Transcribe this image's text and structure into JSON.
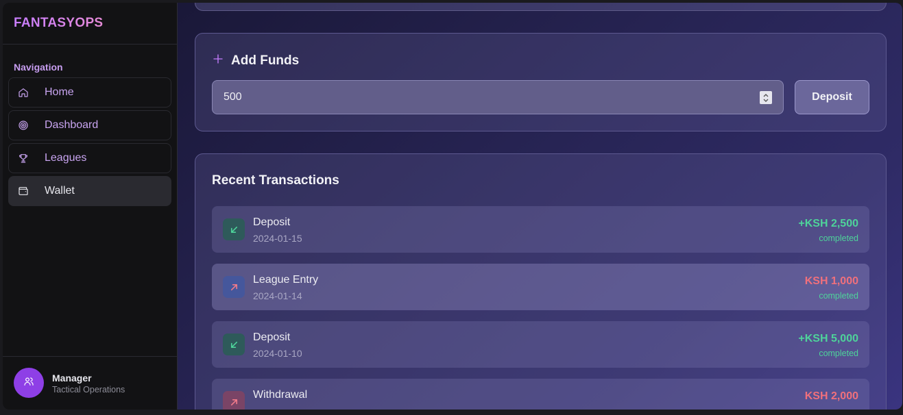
{
  "sidebar": {
    "brand": "FANTASYOPS",
    "nav_title": "Navigation",
    "items": [
      {
        "label": "Home",
        "icon": "home-icon"
      },
      {
        "label": "Dashboard",
        "icon": "target-icon"
      },
      {
        "label": "Leagues",
        "icon": "trophy-icon"
      },
      {
        "label": "Wallet",
        "icon": "wallet-icon",
        "active": true
      }
    ],
    "user": {
      "name": "Manager",
      "role": "Tactical Operations",
      "icon": "users-icon"
    }
  },
  "add_funds": {
    "title": "Add Funds",
    "icon": "plus-icon",
    "amount_value": "500",
    "deposit_label": "Deposit"
  },
  "transactions": {
    "title": "Recent Transactions",
    "rows": [
      {
        "name": "Deposit",
        "date": "2024-01-15",
        "amount": "+KSH 2,500",
        "status": "completed",
        "direction": "in"
      },
      {
        "name": "League Entry",
        "date": "2024-01-14",
        "amount": "KSH 1,000",
        "status": "completed",
        "direction": "out"
      },
      {
        "name": "Deposit",
        "date": "2024-01-10",
        "amount": "+KSH 5,000",
        "status": "completed",
        "direction": "in"
      },
      {
        "name": "Withdrawal",
        "date": "",
        "amount": "KSH 2,000",
        "status": "",
        "direction": "out"
      }
    ]
  },
  "colors": {
    "accent": "#c77dff",
    "positive": "#4ed39a",
    "negative": "#f0707c",
    "avatar": "#8e3fe6"
  }
}
